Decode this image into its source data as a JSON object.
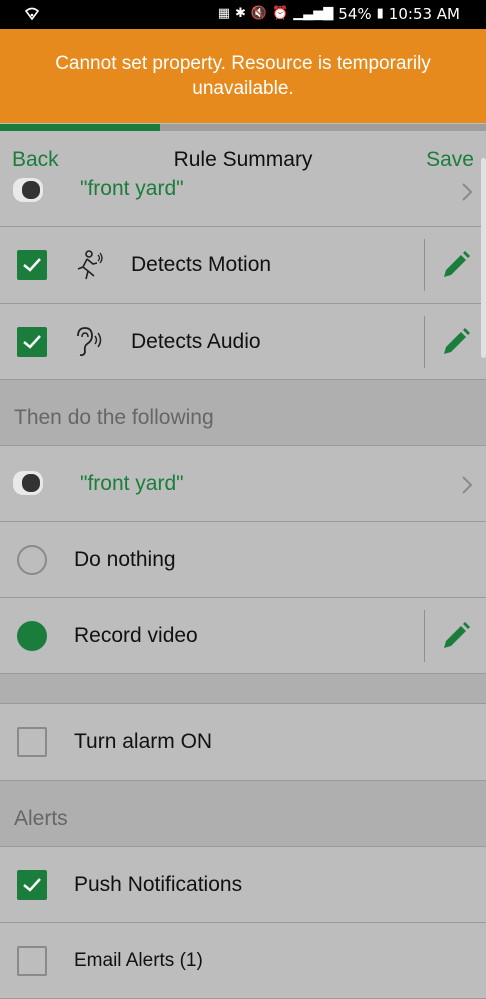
{
  "status_bar": {
    "battery": "54%",
    "time": "10:53 AM"
  },
  "toast": {
    "message": "Cannot set property. Resource is temporarily unavailable."
  },
  "progress": {
    "fraction": 0.33
  },
  "header": {
    "back_label": "Back",
    "title": "Rule Summary",
    "save_label": "Save"
  },
  "triggers": {
    "camera_name": "\"front yard\"",
    "items": [
      {
        "label": "Detects Motion",
        "checked": true
      },
      {
        "label": "Detects Audio",
        "checked": true
      }
    ]
  },
  "actions": {
    "section_title": "Then do the following",
    "camera_name": "\"front yard\"",
    "options": [
      {
        "label": "Do nothing",
        "selected": false
      },
      {
        "label": "Record video",
        "selected": true
      }
    ],
    "alarm_label": "Turn alarm ON"
  },
  "alerts": {
    "section_title": "Alerts",
    "items": [
      {
        "label": "Push Notifications",
        "checked": true
      },
      {
        "label": "Email Alerts (1)",
        "checked": false
      }
    ]
  },
  "colors": {
    "accent": "#1b7d3b",
    "toast": "#e68a1d",
    "background": "#bdbdbd"
  }
}
